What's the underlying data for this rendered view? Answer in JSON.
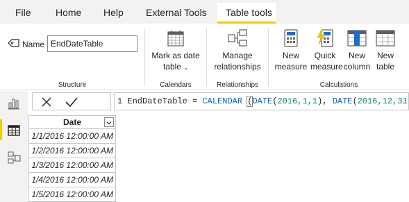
{
  "ribbon_tabs": [
    {
      "label": "File"
    },
    {
      "label": "Home"
    },
    {
      "label": "Help"
    },
    {
      "label": "External Tools"
    },
    {
      "label": "Table tools",
      "active": true
    }
  ],
  "structure": {
    "name_label": "Name",
    "name_value": "EndDateTable",
    "group_label": "Structure"
  },
  "calendars": {
    "mark_as_date_line1": "Mark as date",
    "mark_as_date_line2": "table",
    "group_label": "Calendars"
  },
  "relationships": {
    "manage_line1": "Manage",
    "manage_line2": "relationships",
    "group_label": "Relationships"
  },
  "calculations": {
    "new_measure_line1": "New",
    "new_measure_line2": "measure",
    "quick_measure_line1": "Quick",
    "quick_measure_line2": "measure",
    "new_column_line1": "New",
    "new_column_line2": "column",
    "new_table_line1": "New",
    "new_table_line2": "table",
    "group_label": "Calculations"
  },
  "formula": {
    "line_number": "1",
    "table_name": "EndDateTable",
    "equals": "=",
    "fn_calendar": "CALENDAR",
    "fn_date": "DATE",
    "args1": "2016,1,1",
    "args2": "2016,12,31"
  },
  "table": {
    "header": "Date",
    "rows": [
      "1/1/2016 12:00:00 AM",
      "1/2/2016 12:00:00 AM",
      "1/3/2016 12:00:00 AM",
      "1/4/2016 12:00:00 AM",
      "1/5/2016 12:00:00 AM"
    ]
  },
  "colors": {
    "accent": "#f2c811",
    "icon_blue": "#1b6fc9",
    "keyword_blue": "#0064c8",
    "number_green": "#098658"
  },
  "icons": {
    "name": "tag-icon",
    "mark_as_date": "calendar-icon",
    "manage_relationships": "relationships-icon",
    "new_measure": "calculator-icon",
    "quick_measure": "lightning-calculator-icon",
    "new_column": "column-icon",
    "new_table": "table-icon",
    "rail_report": "bar-chart-icon",
    "rail_data": "grid-icon",
    "rail_model": "model-icon"
  }
}
